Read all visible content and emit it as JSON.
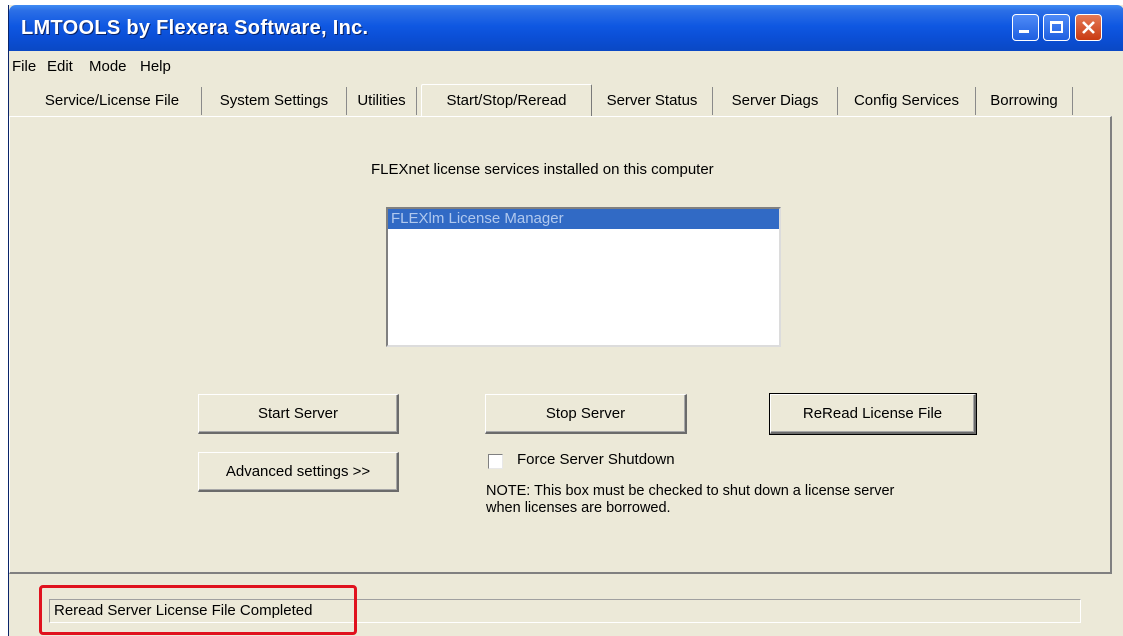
{
  "window": {
    "title": "LMTOOLS by Flexera Software, Inc."
  },
  "menu": [
    "File",
    "Edit",
    "Mode",
    "Help"
  ],
  "tabs": [
    {
      "label": "Service/License File"
    },
    {
      "label": "System Settings"
    },
    {
      "label": "Utilities"
    },
    {
      "label": "Start/Stop/Reread",
      "active": true
    },
    {
      "label": "Server Status"
    },
    {
      "label": "Server Diags"
    },
    {
      "label": "Config Services"
    },
    {
      "label": "Borrowing"
    }
  ],
  "main": {
    "services_heading": "FLEXnet license services installed on this computer",
    "services": [
      "FLEXlm License Manager"
    ],
    "start_button": "Start Server",
    "stop_button": "Stop Server",
    "reread_button": "ReRead License File",
    "advanced_button": "Advanced settings >>",
    "force_shutdown_label": "Force Server Shutdown",
    "force_shutdown_checked": false,
    "note_line1": "NOTE:  This box must be checked to shut down a license server",
    "note_line2": "when licenses are borrowed."
  },
  "status": {
    "message": "Reread Server License File Completed"
  },
  "colors": {
    "titlebar": "#0b4fd6",
    "selection": "#316ac5",
    "highlight": "#e0121e",
    "face": "#ece9d8"
  }
}
